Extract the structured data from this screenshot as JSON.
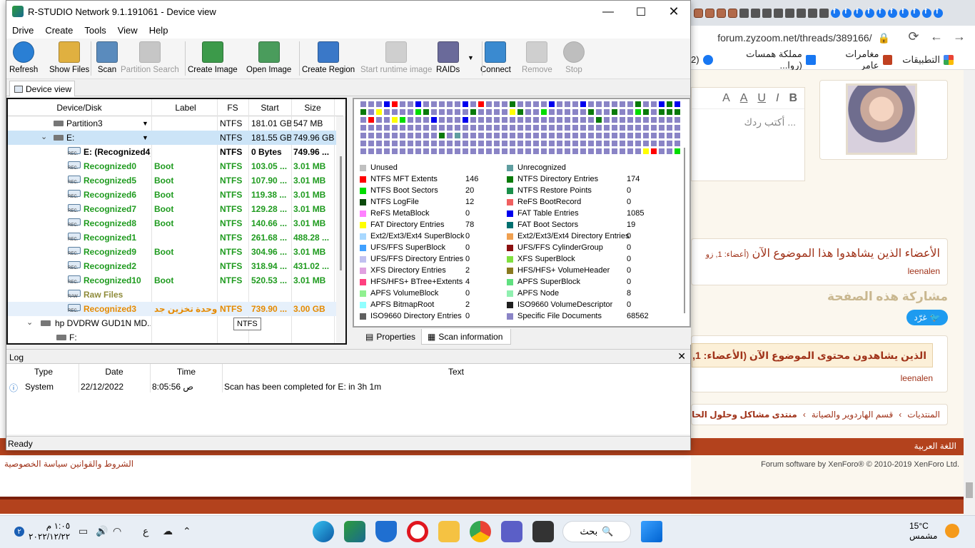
{
  "browser": {
    "url": "forum.zyzoom.net/threads/389166/",
    "bookmarks": [
      "التطبيقات",
      "مغامرات عامر",
      "مملكة همسات (روا...",
      "(2"
    ],
    "editor_placeholder": "أكتب ردك ...",
    "editor_tools": [
      "B",
      "I",
      "U",
      "A",
      "A"
    ],
    "viewers_title": "الأعضاء الذين يشاهدوا هذا الموضوع الآن",
    "viewers_count": "(أعضاء: 1, زو",
    "viewer_name": "leenalen",
    "share_title": "مشاركة هذه الصفحة",
    "tweet_label": "غرّد",
    "viewers2_title": "الذين يشاهدون محتوى الموضوع الآن (الأعضاء: 1, الز",
    "viewer2_name": "leenalen",
    "breadcrumbs": [
      "المنتديات",
      "قسم الهاردوير والصيانة",
      "منتدى مشاكل وحلول الحا"
    ],
    "language": "اللغة العربية",
    "footer_links": "الشروط والقوانين   سياسة الخصوصية",
    "copyright": "Forum software by XenForo® © 2010-2019 XenForo Ltd."
  },
  "window": {
    "title": "R-STUDIO Network 9.1.191061 - Device view",
    "menu": [
      "Drive",
      "Create",
      "Tools",
      "View",
      "Help"
    ],
    "toolbar": [
      {
        "label": "Refresh",
        "icon": "refresh-icon",
        "enabled": true
      },
      {
        "label": "Show Files",
        "icon": "show-files-icon",
        "enabled": true
      },
      {
        "label": "Scan",
        "icon": "scan-icon",
        "enabled": true
      },
      {
        "label": "Partition Search",
        "icon": "partition-search-icon",
        "enabled": false
      },
      {
        "label": "Create Image",
        "icon": "create-image-icon",
        "enabled": true
      },
      {
        "label": "Open Image",
        "icon": "open-image-icon",
        "enabled": true
      },
      {
        "label": "Create Region",
        "icon": "create-region-icon",
        "enabled": true
      },
      {
        "label": "Start runtime image",
        "icon": "runtime-image-icon",
        "enabled": false
      },
      {
        "label": "RAIDs",
        "icon": "raids-icon",
        "enabled": true
      },
      {
        "label": "Connect",
        "icon": "connect-icon",
        "enabled": true
      },
      {
        "label": "Remove",
        "icon": "remove-icon",
        "enabled": false
      },
      {
        "label": "Stop",
        "icon": "stop-icon",
        "enabled": false
      }
    ],
    "device_tab": "Device view",
    "columns": [
      "Device/Disk",
      "Label",
      "FS",
      "Start",
      "Size"
    ],
    "rows": [
      {
        "name": "Partition3",
        "label": "",
        "fs": "NTFS",
        "start": "181.01 GB",
        "size": "547 MB",
        "style": "normal",
        "kind": "drive"
      },
      {
        "name": "E:",
        "label": "",
        "fs": "NTFS",
        "start": "181.55 GB",
        "size": "749.96 GB",
        "style": "normal",
        "kind": "drive",
        "selected": true
      },
      {
        "name": "E: (Recognized4)",
        "label": "",
        "fs": "NTFS",
        "start": "0 Bytes",
        "size": "749.96 ...",
        "style": "bold",
        "kind": "rec"
      },
      {
        "name": "Recognized0",
        "label": "Boot",
        "fs": "NTFS",
        "start": "103.05 ...",
        "size": "3.01 MB",
        "style": "green",
        "kind": "rec"
      },
      {
        "name": "Recognized5",
        "label": "Boot",
        "fs": "NTFS",
        "start": "107.90 ...",
        "size": "3.01 MB",
        "style": "green",
        "kind": "rec"
      },
      {
        "name": "Recognized6",
        "label": "Boot",
        "fs": "NTFS",
        "start": "119.38 ...",
        "size": "3.01 MB",
        "style": "green",
        "kind": "rec"
      },
      {
        "name": "Recognized7",
        "label": "Boot",
        "fs": "NTFS",
        "start": "129.28 ...",
        "size": "3.01 MB",
        "style": "green",
        "kind": "rec"
      },
      {
        "name": "Recognized8",
        "label": "Boot",
        "fs": "NTFS",
        "start": "140.66 ...",
        "size": "3.01 MB",
        "style": "green",
        "kind": "rec"
      },
      {
        "name": "Recognized1",
        "label": "",
        "fs": "NTFS",
        "start": "261.68 ...",
        "size": "488.28 ...",
        "style": "green",
        "kind": "rec"
      },
      {
        "name": "Recognized9",
        "label": "Boot",
        "fs": "NTFS",
        "start": "304.96 ...",
        "size": "3.01 MB",
        "style": "green",
        "kind": "rec"
      },
      {
        "name": "Recognized2",
        "label": "",
        "fs": "NTFS",
        "start": "318.94 ...",
        "size": "431.02 ...",
        "style": "green",
        "kind": "rec"
      },
      {
        "name": "Recognized10",
        "label": "Boot",
        "fs": "NTFS",
        "start": "520.53 ...",
        "size": "3.01 MB",
        "style": "green",
        "kind": "rec"
      },
      {
        "name": "Raw Files",
        "label": "",
        "fs": "",
        "start": "",
        "size": "",
        "style": "olive",
        "kind": "raw"
      },
      {
        "name": "Recognized3",
        "label": "وحدة تخزين جد...",
        "fs": "NTFS",
        "start": "739.90 ...",
        "size": "3.00 GB",
        "style": "orange",
        "kind": "rec",
        "highlight": true
      },
      {
        "name": "hp DVDRW GUD1N MD...",
        "label": "",
        "fs": "",
        "start": "",
        "size": "",
        "style": "normal",
        "kind": "dvd"
      },
      {
        "name": "F:",
        "label": "",
        "fs": "",
        "start": "",
        "size": "",
        "style": "normal",
        "kind": "drive"
      }
    ],
    "tooltip": "NTFS",
    "legend": [
      {
        "name": "Unused",
        "value": "",
        "color": "#c0c0c0"
      },
      {
        "name": "Unrecognized",
        "value": "",
        "color": "#5f9ea0"
      },
      {
        "name": "NTFS MFT Extents",
        "value": "146",
        "color": "#ff0000"
      },
      {
        "name": "NTFS Directory Entries",
        "value": "174",
        "color": "#0a7a0a"
      },
      {
        "name": "NTFS Boot Sectors",
        "value": "20",
        "color": "#00dd00"
      },
      {
        "name": "NTFS Restore Points",
        "value": "0",
        "color": "#1a8f4a"
      },
      {
        "name": "NTFS LogFile",
        "value": "12",
        "color": "#0b4a0b"
      },
      {
        "name": "ReFS BootRecord",
        "value": "0",
        "color": "#f06060"
      },
      {
        "name": "ReFS MetaBlock",
        "value": "0",
        "color": "#ff80ff"
      },
      {
        "name": "FAT Table Entries",
        "value": "1085",
        "color": "#0000ee"
      },
      {
        "name": "FAT Directory Entries",
        "value": "78",
        "color": "#ffff00"
      },
      {
        "name": "FAT Boot Sectors",
        "value": "19",
        "color": "#007070"
      },
      {
        "name": "Ext2/Ext3/Ext4 SuperBlock",
        "value": "0",
        "color": "#a8d8ff"
      },
      {
        "name": "Ext2/Ext3/Ext4 Directory Entries",
        "value": "0",
        "color": "#f0a050"
      },
      {
        "name": "UFS/FFS SuperBlock",
        "value": "0",
        "color": "#40a0ff"
      },
      {
        "name": "UFS/FFS CylinderGroup",
        "value": "0",
        "color": "#8b1010"
      },
      {
        "name": "UFS/FFS Directory Entries",
        "value": "0",
        "color": "#c0c0f0"
      },
      {
        "name": "XFS SuperBlock",
        "value": "0",
        "color": "#80e040"
      },
      {
        "name": "XFS Directory Entries",
        "value": "2",
        "color": "#e0a0e0"
      },
      {
        "name": "HFS/HFS+ VolumeHeader",
        "value": "0",
        "color": "#8a7a20"
      },
      {
        "name": "HFS/HFS+ BTree+Extents",
        "value": "4",
        "color": "#ff4080"
      },
      {
        "name": "APFS SuperBlock",
        "value": "0",
        "color": "#60e080"
      },
      {
        "name": "APFS VolumeBlock",
        "value": "0",
        "color": "#90f090"
      },
      {
        "name": "APFS Node",
        "value": "8",
        "color": "#90f0b0"
      },
      {
        "name": "APFS BitmapRoot",
        "value": "2",
        "color": "#90ffff"
      },
      {
        "name": "ISO9660 VolumeDescriptor",
        "value": "0",
        "color": "#202020"
      },
      {
        "name": "ISO9660 Directory Entries",
        "value": "0",
        "color": "#606060"
      },
      {
        "name": "Specific File Documents",
        "value": "68562",
        "color": "#8a84c6"
      }
    ],
    "bottom_tabs": [
      "Properties",
      "Scan information"
    ],
    "log": {
      "title": "Log",
      "columns": [
        "Type",
        "Date",
        "Time",
        "Text"
      ],
      "entry": {
        "type": "System",
        "date": "22/12/2022",
        "time": "8:05:56 ص",
        "text": "Scan has been completed for E: in 3h 1m"
      }
    },
    "status": "Ready"
  },
  "taskbar": {
    "time": "١:٠٥ م",
    "date": "٢٠٢٢/١٢/٢٢",
    "badge": "٢",
    "lang": "ع",
    "search": "بحث",
    "temp": "15°C",
    "weather": "مشمس"
  }
}
